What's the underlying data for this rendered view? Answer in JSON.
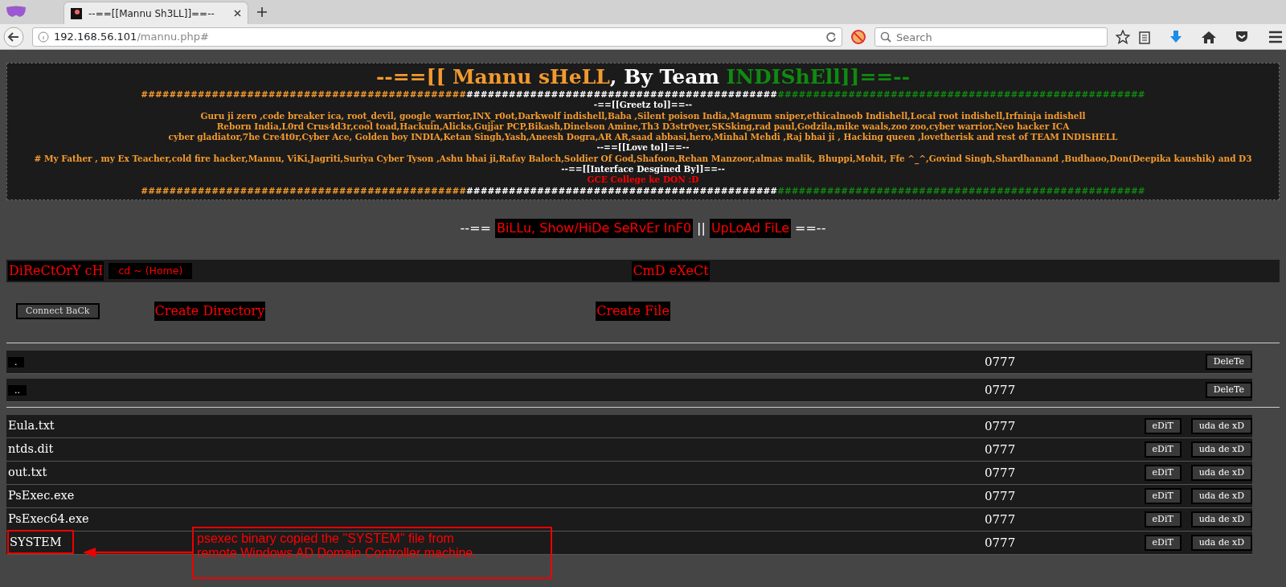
{
  "browser": {
    "tab_title": "--==[[Mannu Sh3LL]]==--",
    "url_host": "192.168.56.101",
    "url_path": "/mannu.php#",
    "search": {
      "placeholder": "Search"
    }
  },
  "banner": {
    "title_parts": [
      {
        "text": "--==[[ Mannu sHeLL",
        "color": "#f39a2e"
      },
      {
        "text": ", By Team ",
        "color": "#ffffff"
      },
      {
        "text": "INDIShEll]]==--",
        "color": "#108a10"
      }
    ],
    "hash_parts": [
      {
        "text": "##############################################",
        "color": "#f39a2e"
      },
      {
        "text": "############################################",
        "color": "#ffffff"
      },
      {
        "text": "####################################################",
        "color": "#108a10"
      }
    ],
    "lines": [
      {
        "kind": "heading",
        "text": "-==[[Greetz to]]==--"
      },
      {
        "kind": "names",
        "text": "Guru ji zero ,code breaker ica, root_devil, google_warrior,INX_r0ot,Darkwolf indishell,Baba ,Silent poison India,Magnum sniper,ethicalnoob Indishell,Local root indishell,Irfninja indishell"
      },
      {
        "kind": "names",
        "text": "Reborn India,L0rd Crus4d3r,cool toad,Hackuin,Alicks,Gujjar PCP,Bikash,Dinelson Amine,Th3 D3str0yer,SKSking,rad paul,Godzila,mike waals,zoo zoo,cyber warrior,Neo hacker ICA"
      },
      {
        "kind": "names",
        "text": "cyber gladiator,7he Cre4t0r,Cyber Ace, Golden boy INDIA,Ketan Singh,Yash,Aneesh Dogra,AR AR,saad abbasi,hero,Minhal Mehdi ,Raj bhai ji , Hacking queen ,lovetherisk and rest of TEAM INDISHELL"
      },
      {
        "kind": "heading",
        "text": "--==[[Love to]]==--"
      },
      {
        "kind": "names",
        "text": "# My Father , my Ex Teacher,cold fire hacker,Mannu, ViKi,Jagriti,Suriya Cyber Tyson ,Ashu bhai ji,Rafay Baloch,Soldier Of God,Shafoon,Rehan Manzoor,almas malik, Bhuppi,Mohit, Ffe ^_^,Govind Singh,Shardhanand ,Budhaoo,Don(Deepika kaushik) and D3"
      },
      {
        "kind": "heading",
        "text": "--==[[Interface Desgined By]]==--"
      },
      {
        "kind": "credit",
        "text": "GCE College ke DON :D"
      }
    ]
  },
  "nav": {
    "prefix": "--==",
    "links": [
      "BiLLu, Show/HiDe SeRvEr InF0",
      "UpLoAd FiLe"
    ],
    "separator": "||",
    "suffix": "==--"
  },
  "toolbar": {
    "dir_label": "DiReCtOrY cH",
    "cd_button": "cd ~ (Home)",
    "cmd_label": "CmD eXeCt"
  },
  "actions": {
    "connect_button": "Connect BaCk",
    "create_directory": "Create Directory",
    "create_file": "Create File"
  },
  "directories": [
    {
      "name": ".",
      "perms": "0777",
      "action": "DeleTe"
    },
    {
      "name": "..",
      "perms": "0777",
      "action": "DeleTe"
    }
  ],
  "files": [
    {
      "name": "Eula.txt",
      "perms": "0777",
      "edit": "eDiT",
      "delete": "uda de xD",
      "highlighted": false
    },
    {
      "name": "ntds.dit",
      "perms": "0777",
      "edit": "eDiT",
      "delete": "uda de xD",
      "highlighted": false
    },
    {
      "name": "out.txt",
      "perms": "0777",
      "edit": "eDiT",
      "delete": "uda de xD",
      "highlighted": false
    },
    {
      "name": "PsExec.exe",
      "perms": "0777",
      "edit": "eDiT",
      "delete": "uda de xD",
      "highlighted": false
    },
    {
      "name": "PsExec64.exe",
      "perms": "0777",
      "edit": "eDiT",
      "delete": "uda de xD",
      "highlighted": false
    },
    {
      "name": "SYSTEM",
      "perms": "0777",
      "edit": "eDiT",
      "delete": "uda de xD",
      "highlighted": true
    }
  ],
  "annotation": {
    "text": "psexec binary copied the \"SYSTEM\" file from remote Windows AD Domain Controller machine."
  }
}
